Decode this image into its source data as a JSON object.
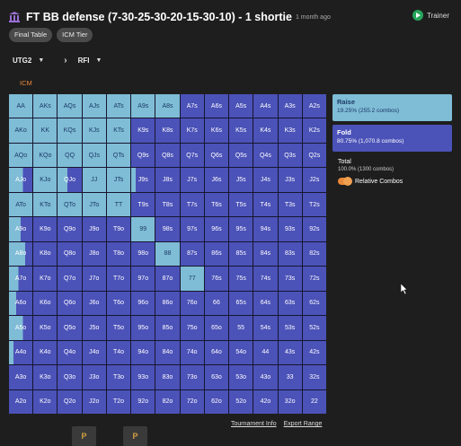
{
  "header": {
    "title": "FT BB defense (7-30-25-30-20-15-30-10) - 1 shortie",
    "time_ago": "1 month ago",
    "trainer_label": "Trainer"
  },
  "chips": [
    "Final Table",
    "ICM Tier"
  ],
  "selectors": {
    "position": "UTG2",
    "action": "RFI"
  },
  "tab": "ICM",
  "grid": {
    "rows": [
      [
        "AA",
        "AKs",
        "AQs",
        "AJs",
        "ATs",
        "A9s",
        "A8s",
        "A7s",
        "A6s",
        "A5s",
        "A4s",
        "A3s",
        "A2s"
      ],
      [
        "AKo",
        "KK",
        "KQs",
        "KJs",
        "KTs",
        "K9s",
        "K8s",
        "K7s",
        "K6s",
        "K5s",
        "K4s",
        "K3s",
        "K2s"
      ],
      [
        "AQo",
        "KQo",
        "QQ",
        "QJs",
        "QTs",
        "Q9s",
        "Q8s",
        "Q7s",
        "Q6s",
        "Q5s",
        "Q4s",
        "Q3s",
        "Q2s"
      ],
      [
        "AJo",
        "KJo",
        "QJo",
        "JJ",
        "JTs",
        "J9s",
        "J8s",
        "J7s",
        "J6s",
        "J5s",
        "J4s",
        "J3s",
        "J2s"
      ],
      [
        "ATo",
        "KTo",
        "QTo",
        "JTo",
        "TT",
        "T9s",
        "T8s",
        "T7s",
        "T6s",
        "T5s",
        "T4s",
        "T3s",
        "T2s"
      ],
      [
        "A9o",
        "K9o",
        "Q9o",
        "J9o",
        "T9o",
        "99",
        "98s",
        "97s",
        "96s",
        "95s",
        "94s",
        "93s",
        "92s"
      ],
      [
        "A8o",
        "K8o",
        "Q8o",
        "J8o",
        "T8o",
        "98o",
        "88",
        "87s",
        "86s",
        "85s",
        "84s",
        "83s",
        "82s"
      ],
      [
        "A7o",
        "K7o",
        "Q7o",
        "J7o",
        "T7o",
        "97o",
        "87o",
        "77",
        "76s",
        "75s",
        "74s",
        "73s",
        "72s"
      ],
      [
        "A6o",
        "K6o",
        "Q6o",
        "J6o",
        "T6o",
        "96o",
        "86o",
        "76o",
        "66",
        "65s",
        "64s",
        "63s",
        "62s"
      ],
      [
        "A5o",
        "K5o",
        "Q5o",
        "J5o",
        "T5o",
        "95o",
        "85o",
        "75o",
        "65o",
        "55",
        "54s",
        "53s",
        "52s"
      ],
      [
        "A4o",
        "K4o",
        "Q4o",
        "J4o",
        "T4o",
        "94o",
        "84o",
        "74o",
        "64o",
        "54o",
        "44",
        "43s",
        "42s"
      ],
      [
        "A3o",
        "K3o",
        "Q3o",
        "J3o",
        "T3o",
        "93o",
        "83o",
        "73o",
        "63o",
        "53o",
        "43o",
        "33",
        "32s"
      ],
      [
        "A2o",
        "K2o",
        "Q2o",
        "J2o",
        "T2o",
        "92o",
        "82o",
        "72o",
        "62o",
        "52o",
        "42o",
        "32o",
        "22"
      ]
    ],
    "raise_fraction": [
      [
        1,
        1,
        1,
        1,
        1,
        1,
        1,
        0,
        0,
        0,
        0,
        0,
        0
      ],
      [
        1,
        1,
        1,
        1,
        1,
        0,
        0,
        0,
        0,
        0,
        0,
        0,
        0
      ],
      [
        1,
        1,
        1,
        1,
        1,
        0,
        0,
        0,
        0,
        0,
        0,
        0,
        0
      ],
      [
        0.6,
        1,
        0.4,
        1,
        1,
        0.2,
        0,
        0,
        0,
        0,
        0,
        0,
        0
      ],
      [
        1,
        1,
        1,
        1,
        1,
        0,
        0,
        0,
        0,
        0,
        0,
        0,
        0
      ],
      [
        0.5,
        0,
        0,
        0,
        0,
        1,
        0,
        0,
        0,
        0,
        0,
        0,
        0
      ],
      [
        0.7,
        0,
        0,
        0,
        0,
        0,
        1,
        0,
        0,
        0,
        0,
        0,
        0
      ],
      [
        0.4,
        0,
        0,
        0,
        0,
        0,
        0,
        1,
        0,
        0,
        0,
        0,
        0
      ],
      [
        0.3,
        0,
        0,
        0,
        0,
        0,
        0,
        0,
        0,
        0,
        0,
        0,
        0
      ],
      [
        0.6,
        0,
        0,
        0,
        0,
        0,
        0,
        0,
        0,
        0,
        0,
        0,
        0
      ],
      [
        0.2,
        0,
        0,
        0,
        0,
        0,
        0,
        0,
        0,
        0,
        0,
        0,
        0
      ],
      [
        0,
        0,
        0,
        0,
        0,
        0,
        0,
        0,
        0,
        0,
        0,
        0,
        0
      ],
      [
        0,
        0,
        0,
        0,
        0,
        0,
        0,
        0,
        0,
        0,
        0,
        0,
        0
      ]
    ]
  },
  "legend": {
    "raise": {
      "label": "Raise",
      "value": "19.25% (255.2 combos)"
    },
    "fold": {
      "label": "Fold",
      "value": "80.75% (1,070.8 combos)"
    },
    "total": {
      "label": "Total",
      "value": "100.0% (1300 combos)"
    },
    "relative_combos": "Relative Combos"
  },
  "footer": {
    "tournament_info": "Tournament Info",
    "export_range": "Export Range"
  },
  "thumbs": [
    "P",
    "P"
  ],
  "colors": {
    "raise": "#7fbcd6",
    "fold": "#4b52b8",
    "accent": "#e8883a",
    "trainer": "#26a65b"
  }
}
